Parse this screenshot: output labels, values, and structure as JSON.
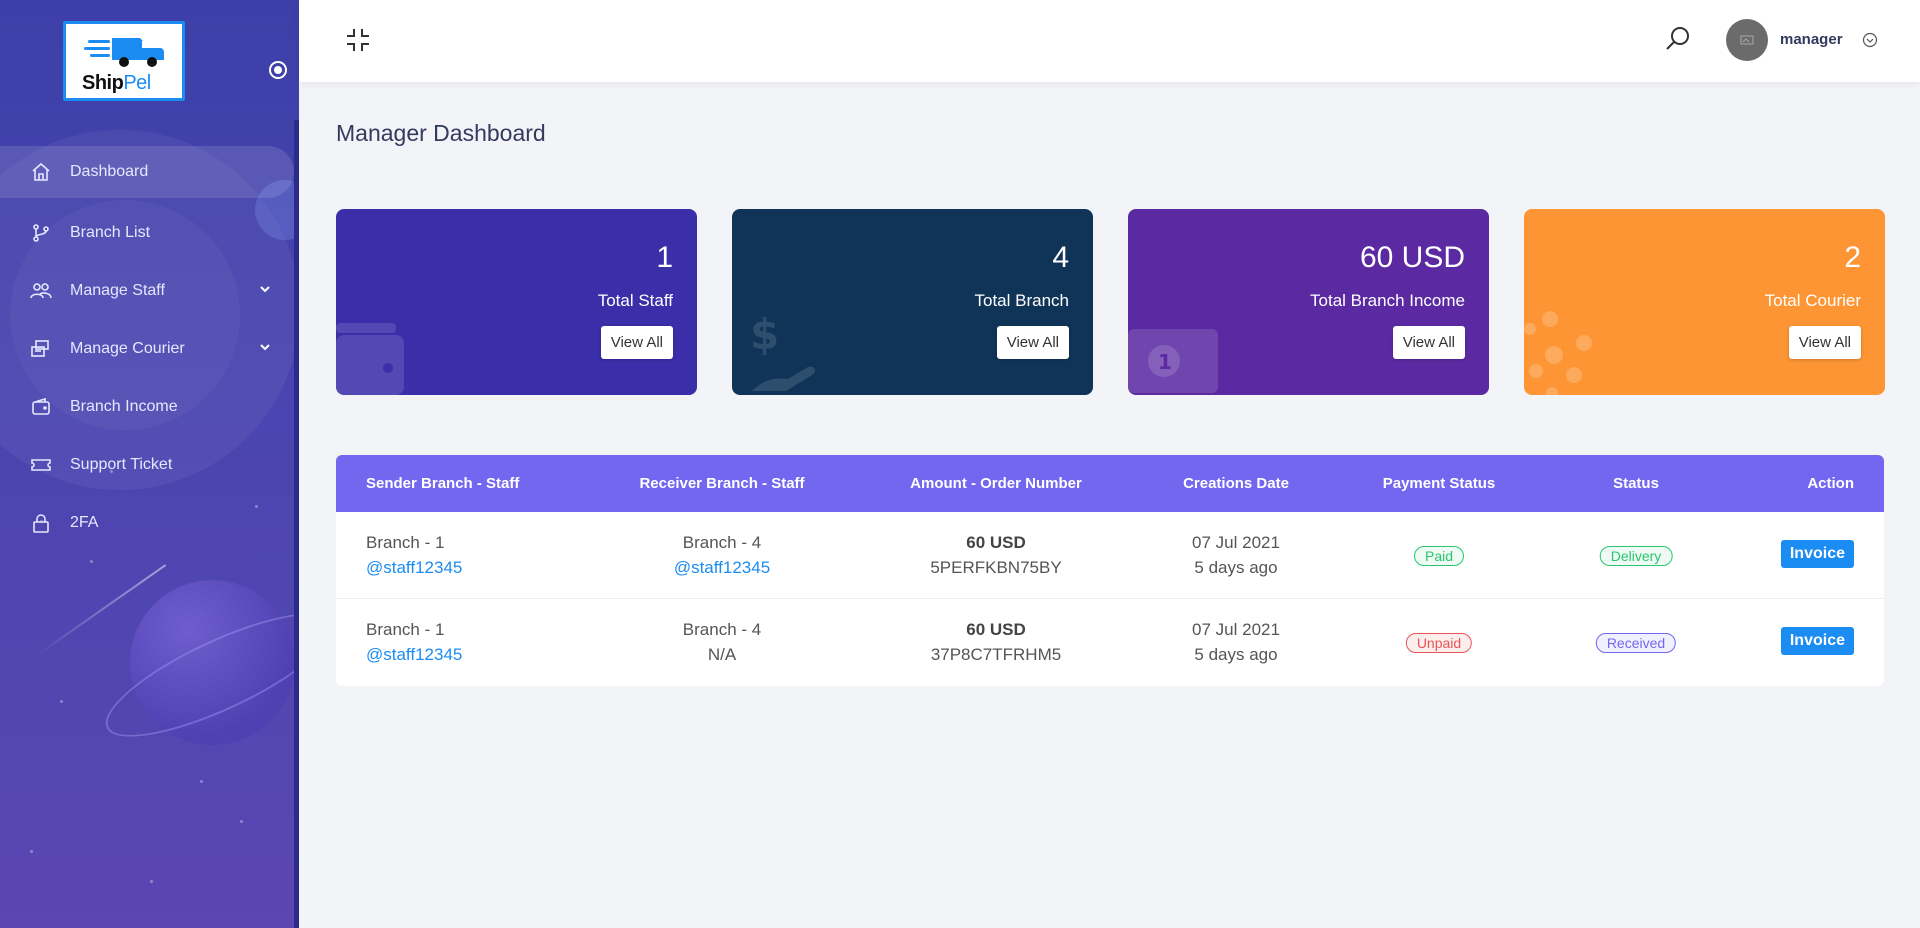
{
  "brand": {
    "name_part1": "Ship",
    "name_part2": "Pel"
  },
  "sidebar": {
    "items": [
      {
        "label": "Dashboard",
        "icon": "home-icon",
        "active": true
      },
      {
        "label": "Branch List",
        "icon": "branch-icon"
      },
      {
        "label": "Manage Staff",
        "icon": "users-icon",
        "has_submenu": true
      },
      {
        "label": "Manage Courier",
        "icon": "courier-icon",
        "has_submenu": true
      },
      {
        "label": "Branch Income",
        "icon": "wallet-icon"
      },
      {
        "label": "Support Ticket",
        "icon": "ticket-icon"
      },
      {
        "label": "2FA",
        "icon": "lock-icon"
      }
    ]
  },
  "header": {
    "user_name": "manager"
  },
  "page_title": "Manager Dashboard",
  "cards": [
    {
      "value": "1",
      "label": "Total Staff",
      "button": "View All",
      "color": "#3a2ea9"
    },
    {
      "value": "4",
      "label": "Total Branch",
      "button": "View All",
      "color": "#103458"
    },
    {
      "value": "60 USD",
      "label": "Total Branch Income",
      "button": "View All",
      "color": "#5b2aa3"
    },
    {
      "value": "2",
      "label": "Total Courier",
      "button": "View All",
      "color": "#fd9535"
    }
  ],
  "table": {
    "headers": [
      "Sender Branch - Staff",
      "Receiver Branch - Staff",
      "Amount - Order Number",
      "Creations Date",
      "Payment Status",
      "Status",
      "Action"
    ],
    "rows": [
      {
        "sender_branch": "Branch - 1",
        "sender_staff": "@staff12345",
        "receiver_branch": "Branch - 4",
        "receiver_staff": "@staff12345",
        "amount": "60 USD",
        "order": "5PERFKBN75BY",
        "date": "07 Jul 2021",
        "ago": "5 days ago",
        "payment": "Paid",
        "status": "Delivery",
        "action": "Invoice"
      },
      {
        "sender_branch": "Branch - 1",
        "sender_staff": "@staff12345",
        "receiver_branch": "Branch - 4",
        "receiver_staff": "N/A",
        "amount": "60 USD",
        "order": "37P8C7TFRHM5",
        "date": "07 Jul 2021",
        "ago": "5 days ago",
        "payment": "Unpaid",
        "status": "Received",
        "action": "Invoice"
      }
    ]
  },
  "colors": {
    "accent": "#7367f0",
    "link": "#1b8cf2",
    "sidebar": "#4a45b0"
  }
}
